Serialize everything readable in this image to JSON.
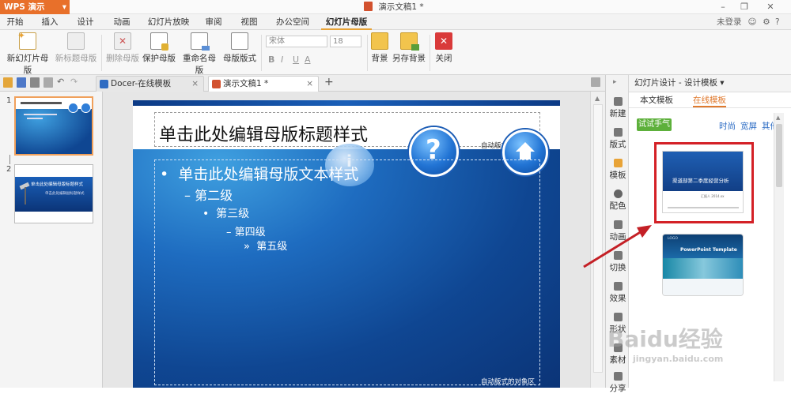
{
  "titlebar": {
    "app_name": "WPS 演示",
    "app_caret": "▾",
    "document_title": "演示文稿1 *",
    "minimize": "–",
    "restore": "❐",
    "close": "✕"
  },
  "menubar": {
    "tabs": [
      "开始",
      "插入",
      "设计",
      "动画",
      "幻灯片放映",
      "审阅",
      "视图",
      "办公空间",
      "幻灯片母版"
    ],
    "active_tab": "幻灯片母版",
    "login": "未登录",
    "help": "?"
  },
  "ribbon": {
    "new_master": "新幻灯片母版",
    "new_title_master": "新标题母版",
    "delete_master": "删除母版",
    "protect_master": "保护母版",
    "rename_master": "重命名母版",
    "master_layout": "母版版式",
    "font_name": "宋体",
    "font_size": "18",
    "bold": "B",
    "italic": "I",
    "underline": "U",
    "font_color": "A",
    "background": "背景",
    "save_background": "另存背景",
    "close": "关闭"
  },
  "doc_tabs": [
    {
      "label": "Docer-在线模板",
      "close": "×"
    },
    {
      "label": "演示文稿1 *",
      "close": "×"
    }
  ],
  "add_tab": "+",
  "thumbnails": {
    "numbers": [
      "1",
      "2"
    ],
    "thumb2_title": "单击此处编辑母版标题样式",
    "thumb2_sub": "单击此处编辑副标题样式"
  },
  "slide": {
    "title": "单击此处编辑母版标题样式",
    "title_label": "自动版式的标题区",
    "body_label": "自动版式的对象区",
    "levels": [
      {
        "bullet": "•",
        "text": "单击此处编辑母版文本样式"
      },
      {
        "bullet": "–",
        "text": "第二级"
      },
      {
        "bullet": "•",
        "text": "第三级"
      },
      {
        "bullet": "–",
        "text": "第四级"
      },
      {
        "bullet": "»",
        "text": "第五级"
      }
    ]
  },
  "side_tools": [
    "新建",
    "版式",
    "模板",
    "配色",
    "动画",
    "切换",
    "效果",
    "形状",
    "素材",
    "分享"
  ],
  "panel": {
    "header": "幻灯片设计 - 设计模板 ▾",
    "tabs": [
      "本文模板",
      "在线模板"
    ],
    "active_tab": "在线模板",
    "try_button": "试试手气",
    "filters": [
      "时尚",
      "宽屏",
      "其他"
    ],
    "template1_title": "渠道部第二季度经营分析",
    "template1_sub": "汇报人 2014.xx",
    "template2_title": "PowerPoint Template",
    "template2_logo": "LOGO"
  },
  "watermark": {
    "logo": "Baidu经验",
    "url": "jingyan.baidu.com"
  },
  "colors": {
    "accent": "#e8702a",
    "slide_blue": "#0f4692",
    "highlight": "#d42127"
  }
}
